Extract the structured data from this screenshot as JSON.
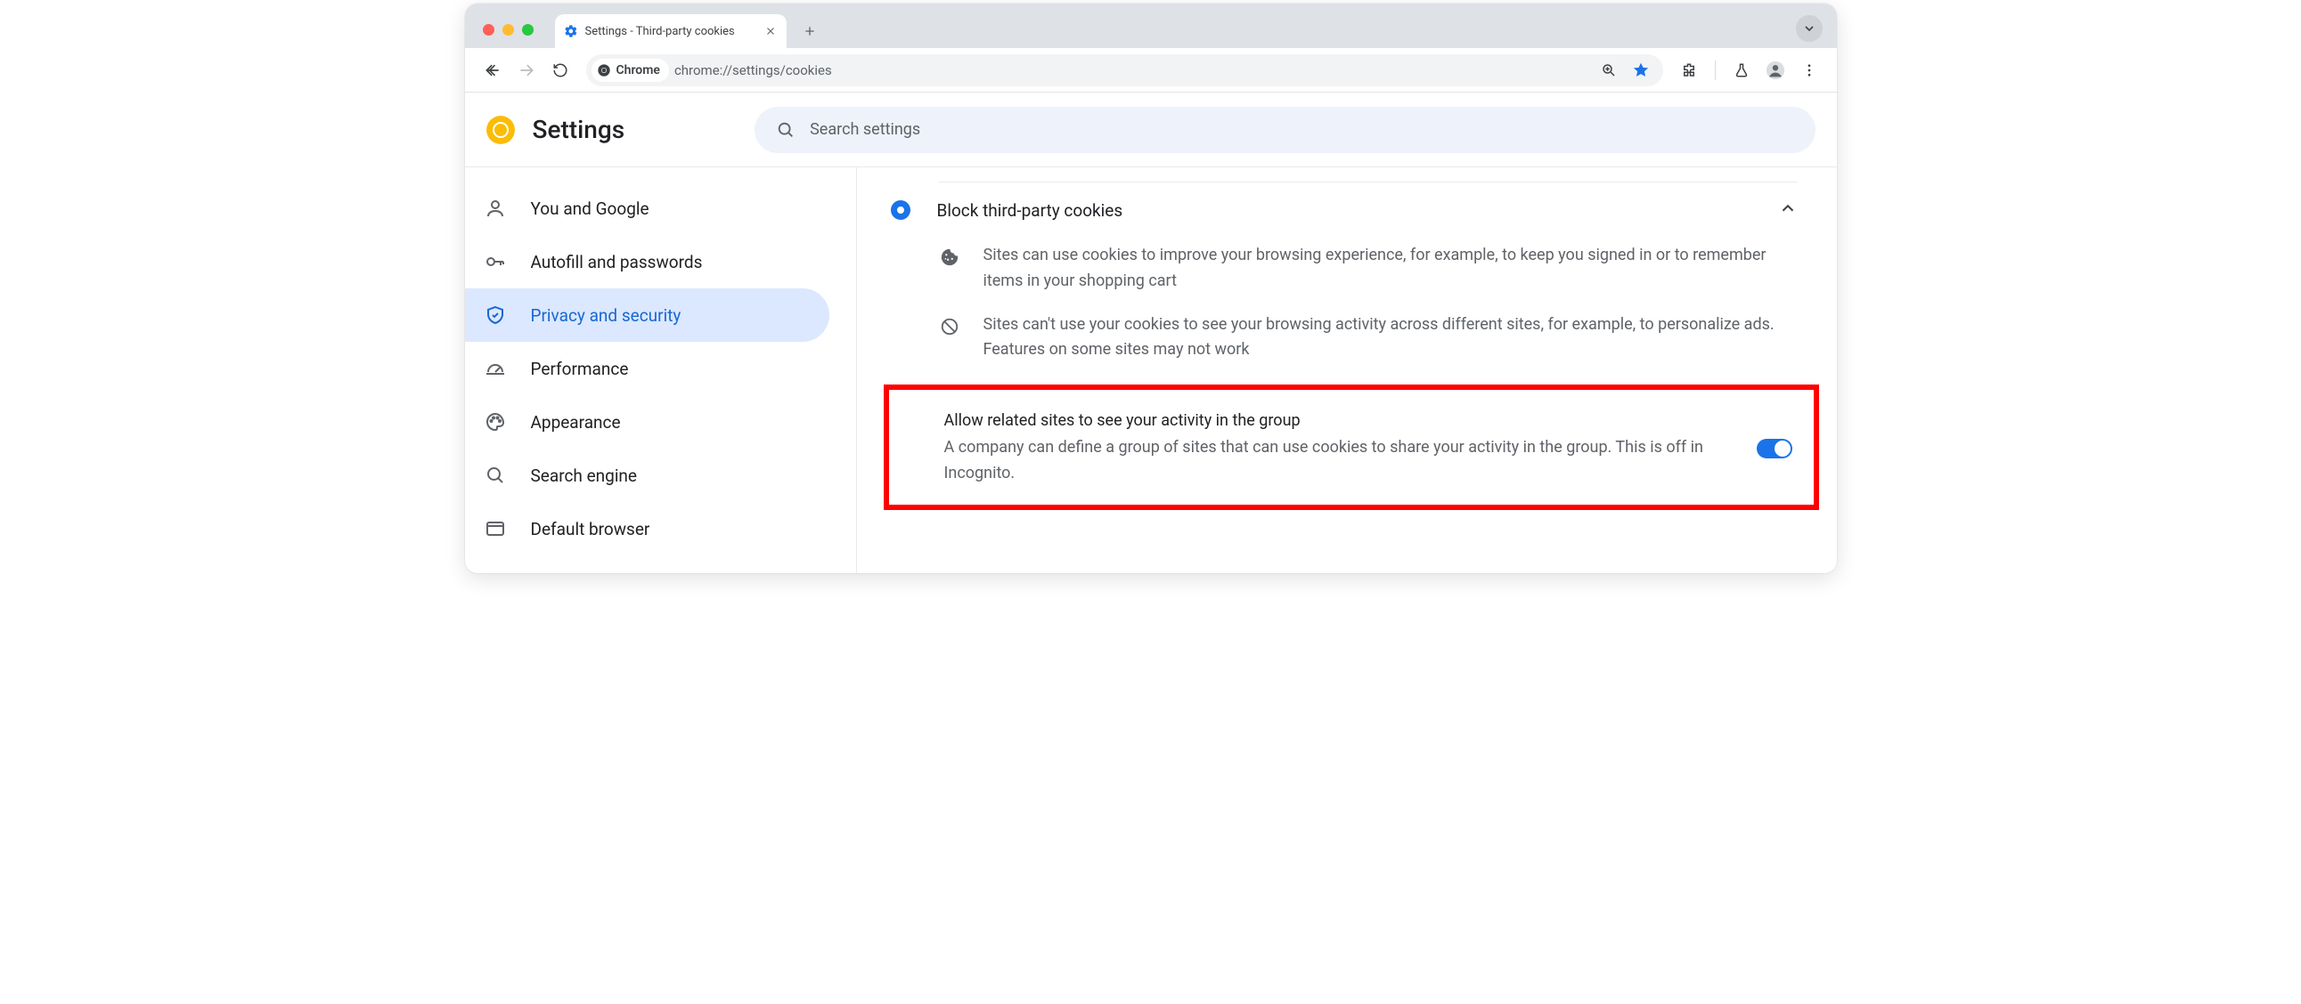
{
  "window": {
    "tab_title": "Settings - Third-party cookies"
  },
  "toolbar": {
    "chrome_chip": "Chrome",
    "url": "chrome://settings/cookies"
  },
  "header": {
    "title": "Settings",
    "search_placeholder": "Search settings"
  },
  "sidebar": {
    "items": [
      {
        "label": "You and Google"
      },
      {
        "label": "Autofill and passwords"
      },
      {
        "label": "Privacy and security"
      },
      {
        "label": "Performance"
      },
      {
        "label": "Appearance"
      },
      {
        "label": "Search engine"
      },
      {
        "label": "Default browser"
      }
    ]
  },
  "main": {
    "option_title": "Block third-party cookies",
    "desc1": "Sites can use cookies to improve your browsing experience, for example, to keep you signed in or to remember items in your shopping cart",
    "desc2": "Sites can't use your cookies to see your browsing activity across different sites, for example, to personalize ads. Features on some sites may not work",
    "allow_title": "Allow related sites to see your activity in the group",
    "allow_sub": "A company can define a group of sites that can use cookies to share your activity in the group. This is off in Incognito."
  }
}
